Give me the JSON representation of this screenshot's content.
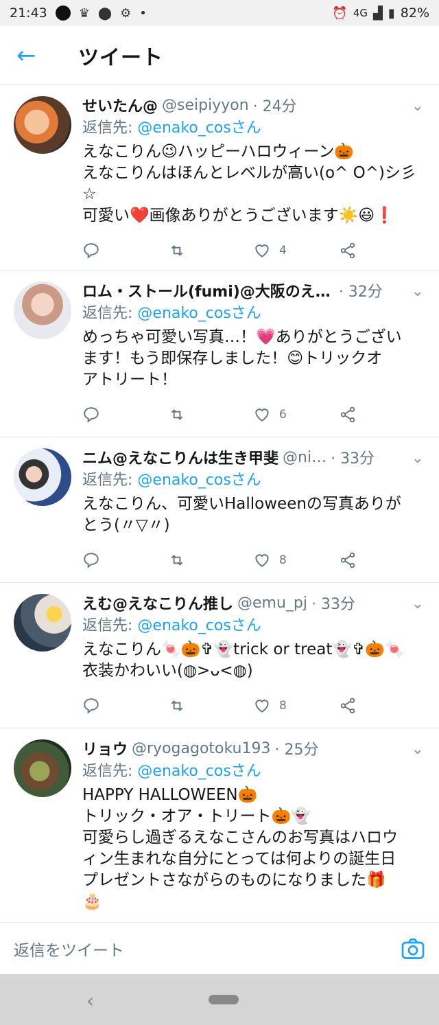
{
  "status_bar": {
    "time": "21:43",
    "network": "4G",
    "battery": "82%"
  },
  "header": {
    "back_icon": "arrow-left-icon",
    "title": "ツイート"
  },
  "tweets": [
    {
      "name": "せいたん@",
      "handle": "@seipiyyon",
      "time": "· 24分",
      "reply_label": "返信先: ",
      "reply_to": "@enako_cosさん",
      "text": "えなこりん😉ハッピーハロウィーン🎃\nえなこりんはほんとレベルが高い(o^ O^)シ彡\n☆\n可愛い❤️画像ありがとうございます☀️😃❗",
      "likes": "4"
    },
    {
      "name": "ロム・ストール(fumi)@大阪のえ…",
      "handle": "",
      "time": "· 32分",
      "reply_label": "返信先: ",
      "reply_to": "@enako_cosさん",
      "text": "めっちゃ可愛い写真…！💗ありがとうござい\nます！もう即保存しました！😊トリックオ\nアトリート！",
      "likes": "6"
    },
    {
      "name": "ニム@えなこりんは生き甲斐",
      "handle": "@ni…",
      "time": "· 33分",
      "reply_label": "返信先: ",
      "reply_to": "@enako_cosさん",
      "text": "えなこりん、可愛いHalloweenの写真ありが\nとう(〃▽〃)",
      "likes": "8"
    },
    {
      "name": "えむ@えなこりん推し",
      "handle": "@emu_pj",
      "time": "· 33分",
      "reply_label": "返信先: ",
      "reply_to": "@enako_cosさん",
      "text": "えなこりん🍬🎃✞👻trick or treat👻✞🎃🍬\n衣装かわいい(◍>ᴗ<◍)",
      "likes": "8"
    },
    {
      "name": "リョウ",
      "handle": "@ryogagotoku193",
      "time": "· 25分",
      "reply_label": "返信先: ",
      "reply_to": "@enako_cosさん",
      "text": "HAPPY HALLOWEEN🎃\nトリック・オア・トリート🎃👻\n可愛らし過ぎるえなこさんのお写真はハロウ\nィン生まれな自分にとっては何よりの誕生日\nプレゼントさながらのものになりました🎁\n🎂",
      "likes": ""
    }
  ],
  "reply_bar": {
    "placeholder": "返信をツイート"
  },
  "colors": {
    "accent": "#1da1f2",
    "muted": "#657786"
  }
}
